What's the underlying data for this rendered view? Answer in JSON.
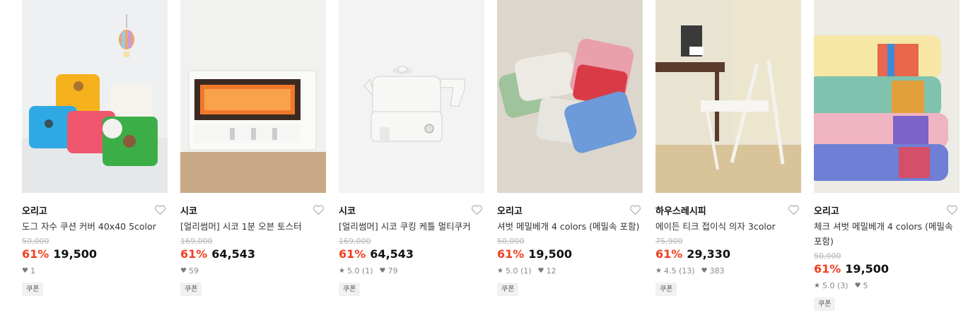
{
  "products": [
    {
      "brand": "오리고",
      "title": "도그 자수 쿠션 커버 40x40 5color",
      "original_price": "50,000",
      "discount": "61%",
      "price": "19,500",
      "rating": "",
      "likes": "1",
      "badge": "쿠폰",
      "image_icon": "cushion-photo"
    },
    {
      "brand": "시코",
      "title": "[얼리썸머] 시코 1분 오븐 토스터",
      "original_price": "169,000",
      "discount": "61%",
      "price": "64,543",
      "rating": "",
      "likes": "59",
      "badge": "쿠폰",
      "image_icon": "toaster-photo"
    },
    {
      "brand": "시코",
      "title": "[얼리썸머] 시코 쿠킹 케틀 멀티쿠커",
      "original_price": "169,000",
      "discount": "61%",
      "price": "64,543",
      "rating": "5.0 (1)",
      "likes": "79",
      "badge": "쿠폰",
      "image_icon": "kettle-photo"
    },
    {
      "brand": "오리고",
      "title": "셔벗 메밀베개 4 colors (메밀속 포함)",
      "original_price": "50,000",
      "discount": "61%",
      "price": "19,500",
      "rating": "5.0 (1)",
      "likes": "12",
      "badge": "쿠폰",
      "image_icon": "pillows-photo"
    },
    {
      "brand": "하우스레시피",
      "title": "에이든 티크 접이식 의자 3color",
      "original_price": "75,900",
      "discount": "61%",
      "price": "29,330",
      "rating": "4.5 (13)",
      "likes": "383",
      "badge": "쿠폰",
      "image_icon": "chair-photo"
    },
    {
      "brand": "오리고",
      "title": "체크 셔벗 메밀베개 4 colors (메밀속 포함)",
      "original_price": "50,000",
      "discount": "61%",
      "price": "19,500",
      "rating": "5.0 (3)",
      "likes": "5",
      "badge": "쿠폰",
      "image_icon": "check-pillows-photo"
    }
  ],
  "icons": {
    "wishlist": "heart-outline-icon",
    "star": "star-icon",
    "like": "heart-filled-icon"
  },
  "colors": {
    "discount": "#f2401f",
    "price": "#111111",
    "strike": "#b5b5b5",
    "badge_bg": "#f1f1f1"
  }
}
